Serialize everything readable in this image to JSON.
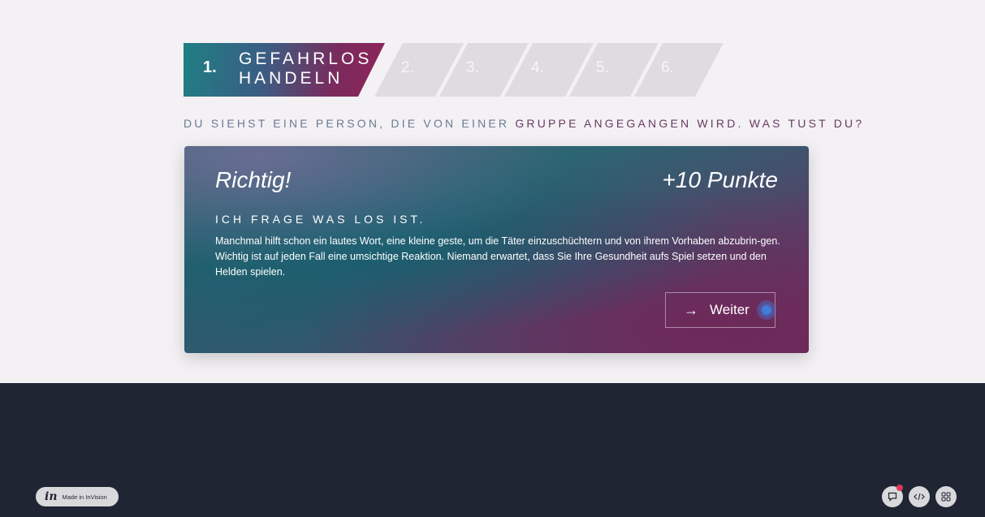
{
  "progress": {
    "active_step": {
      "number": "1.",
      "title_line1": "GEFAHRLOS",
      "title_line2": "HANDELN"
    },
    "steps": [
      "2.",
      "3.",
      "4.",
      "5.",
      "6."
    ]
  },
  "question": {
    "part1": "DU SIEHST EINE PERSON, DIE VON EINER ",
    "part2": "GRUPPE ANGEGANGEN WIRD. WAS TUST DU?"
  },
  "result": {
    "verdict": "Richtig!",
    "points": "+10 Punkte",
    "answer": "ICH FRAGE WAS LOS IST.",
    "text": "Manchmal hilft schon ein lautes Wort, eine kleine geste, um die Täter einzuschüchtern und von ihrem Vorhaben abzubrin-gen. Wichtig ist auf jeden Fall eine umsichtige Reaktion. Niemand erwartet, dass Sie Ihre Gesundheit aufs Spiel setzen und den Helden spielen.",
    "button_arrow": "→",
    "button_label": "Weiter"
  },
  "footer": {
    "badge_logo": "in",
    "badge_text": "Made in InVision",
    "tools": [
      "comment-icon",
      "code-icon",
      "grid-icon"
    ]
  },
  "colors": {
    "page_bg": "#f3f1f4",
    "footer_bg": "#1f2533",
    "accent_teal": "#1f7f84",
    "accent_magenta": "#8e2459",
    "notification": "#e0355b"
  }
}
